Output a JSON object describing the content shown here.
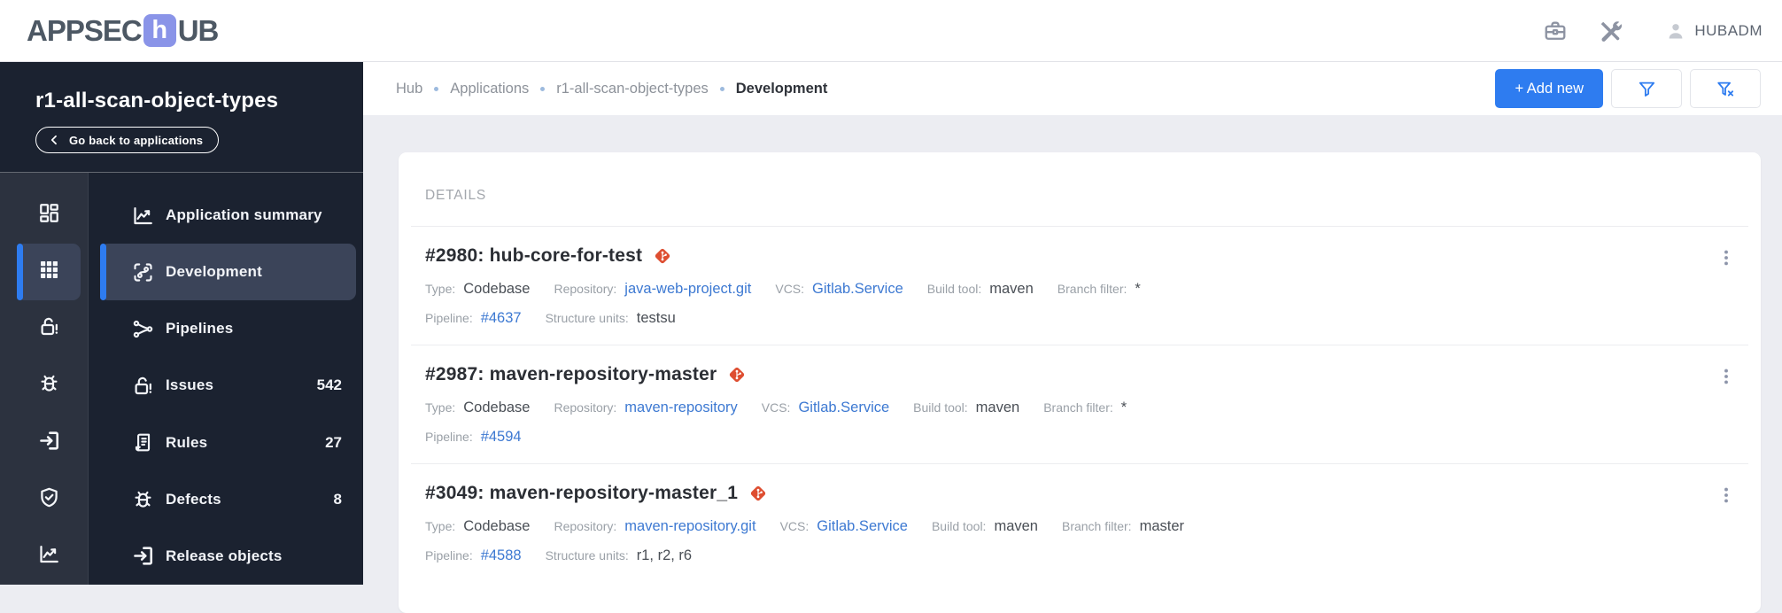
{
  "header": {
    "logo_part1": "APPSEC",
    "logo_mid": "h",
    "logo_part2": "UB",
    "username": "HUBADM"
  },
  "sidebar": {
    "app_title": "r1-all-scan-object-types",
    "back_label": "Go back to applications",
    "rail": [
      {
        "icon": "dashboard-icon",
        "selected": false
      },
      {
        "icon": "apps-grid-icon",
        "selected": true
      },
      {
        "icon": "lock-alert-icon",
        "selected": false
      },
      {
        "icon": "bug-icon",
        "selected": false
      },
      {
        "icon": "sign-in-icon",
        "selected": false
      },
      {
        "icon": "shield-check-icon",
        "selected": false
      },
      {
        "icon": "chart-line-icon",
        "selected": false
      }
    ],
    "items": [
      {
        "label": "Application summary",
        "icon": "chart-line-icon",
        "badge": "",
        "selected": false
      },
      {
        "label": "Development",
        "icon": "development-icon",
        "badge": "",
        "selected": true
      },
      {
        "label": "Pipelines",
        "icon": "pipelines-icon",
        "badge": "",
        "selected": false
      },
      {
        "label": "Issues",
        "icon": "lock-alert-icon",
        "badge": "542",
        "selected": false
      },
      {
        "label": "Rules",
        "icon": "rules-icon",
        "badge": "27",
        "selected": false
      },
      {
        "label": "Defects",
        "icon": "bug-icon",
        "badge": "8",
        "selected": false
      },
      {
        "label": "Release objects",
        "icon": "sign-in-icon",
        "badge": "",
        "selected": false
      }
    ]
  },
  "breadcrumb": [
    "Hub",
    "Applications",
    "r1-all-scan-object-types",
    "Development"
  ],
  "toolbar": {
    "add_new_label": "+ Add new"
  },
  "details": {
    "heading": "DETAILS",
    "rows": [
      {
        "title": "#2980: hub-core-for-test",
        "meta": [
          [
            {
              "label": "Type:",
              "value": "Codebase",
              "link": false
            },
            {
              "label": "Repository:",
              "value": "java-web-project.git",
              "link": true
            },
            {
              "label": "VCS:",
              "value": "Gitlab.Service",
              "link": true
            },
            {
              "label": "Build tool:",
              "value": "maven",
              "link": false
            },
            {
              "label": "Branch filter:",
              "value": "*",
              "link": false
            }
          ],
          [
            {
              "label": "Pipeline:",
              "value": "#4637",
              "link": true
            },
            {
              "label": "Structure units:",
              "value": "testsu",
              "link": false
            }
          ]
        ]
      },
      {
        "title": "#2987: maven-repository-master",
        "meta": [
          [
            {
              "label": "Type:",
              "value": "Codebase",
              "link": false
            },
            {
              "label": "Repository:",
              "value": "maven-repository",
              "link": true
            },
            {
              "label": "VCS:",
              "value": "Gitlab.Service",
              "link": true
            },
            {
              "label": "Build tool:",
              "value": "maven",
              "link": false
            },
            {
              "label": "Branch filter:",
              "value": "*",
              "link": false
            }
          ],
          [
            {
              "label": "Pipeline:",
              "value": "#4594",
              "link": true
            }
          ]
        ]
      },
      {
        "title": "#3049: maven-repository-master_1",
        "meta": [
          [
            {
              "label": "Type:",
              "value": "Codebase",
              "link": false
            },
            {
              "label": "Repository:",
              "value": "maven-repository.git",
              "link": true
            },
            {
              "label": "VCS:",
              "value": "Gitlab.Service",
              "link": true
            },
            {
              "label": "Build tool:",
              "value": "maven",
              "link": false
            },
            {
              "label": "Branch filter:",
              "value": "master",
              "link": false
            }
          ],
          [
            {
              "label": "Pipeline:",
              "value": "#4588",
              "link": true
            },
            {
              "label": "Structure units:",
              "value": "r1,  r2,  r6",
              "link": false
            }
          ]
        ]
      }
    ]
  },
  "colors": {
    "accent_blue": "#2e7cf0",
    "link_blue": "#3d79d2",
    "git_red": "#de4e31",
    "sidebar_bg": "#1b2230",
    "rail_bg": "#2c323f",
    "selected_bg": "#3b4459",
    "content_bg": "#ecedf2",
    "logo_block": "#8a94e8"
  }
}
